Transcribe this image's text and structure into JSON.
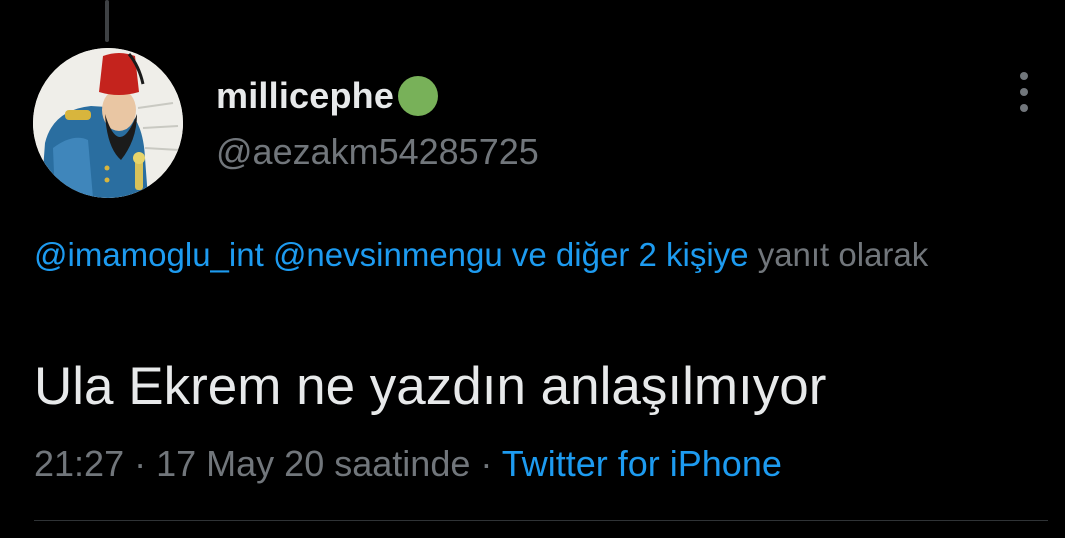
{
  "tweet": {
    "author": {
      "display_name": "millicephe",
      "status_emoji_color": "#78b159",
      "handle": "@aezakm54285725",
      "avatar_icon": "portrait-avatar"
    },
    "more_icon": "more-vertical-icon",
    "reply_context": {
      "mentions": [
        "@imamoglu_int",
        "@nevsinmengu"
      ],
      "others_text": "ve diğer 2 kişiye",
      "suffix": "yanıt olarak"
    },
    "text": "Ula Ekrem ne yazdın anlaşılmıyor",
    "meta": {
      "time": "21:27",
      "separator": "·",
      "date": "17 May 20",
      "date_suffix": "saatinde",
      "source": "Twitter for iPhone"
    }
  },
  "colors": {
    "background": "#000000",
    "primary_text": "#e7e9ea",
    "secondary_text": "#71767b",
    "link": "#1d9bf0",
    "divider": "#2f3336"
  }
}
